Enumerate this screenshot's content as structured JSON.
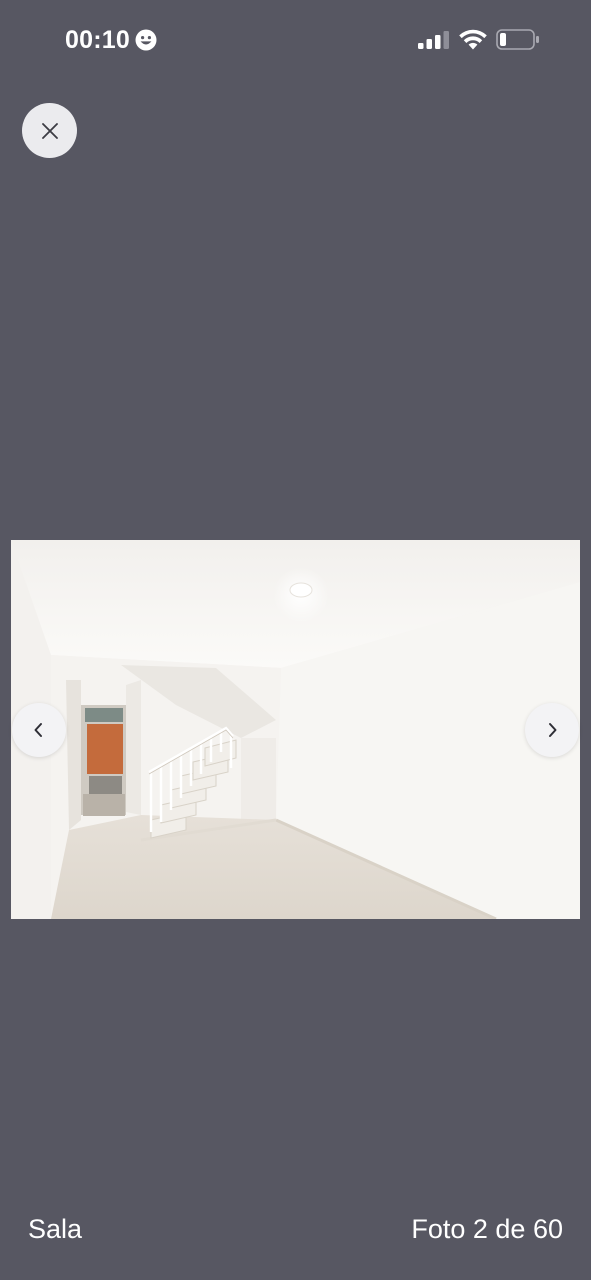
{
  "status_bar": {
    "time": "00:10",
    "icons": [
      "smiley-icon",
      "cellular-signal-icon",
      "wifi-icon",
      "battery-icon"
    ]
  },
  "gallery": {
    "close_icon": "close-icon",
    "prev_icon": "chevron-left-icon",
    "next_icon": "chevron-right-icon",
    "caption": "Sala",
    "counter": "Foto 2 de 60"
  },
  "colors": {
    "background": "#575762",
    "button": "#ebebee"
  }
}
